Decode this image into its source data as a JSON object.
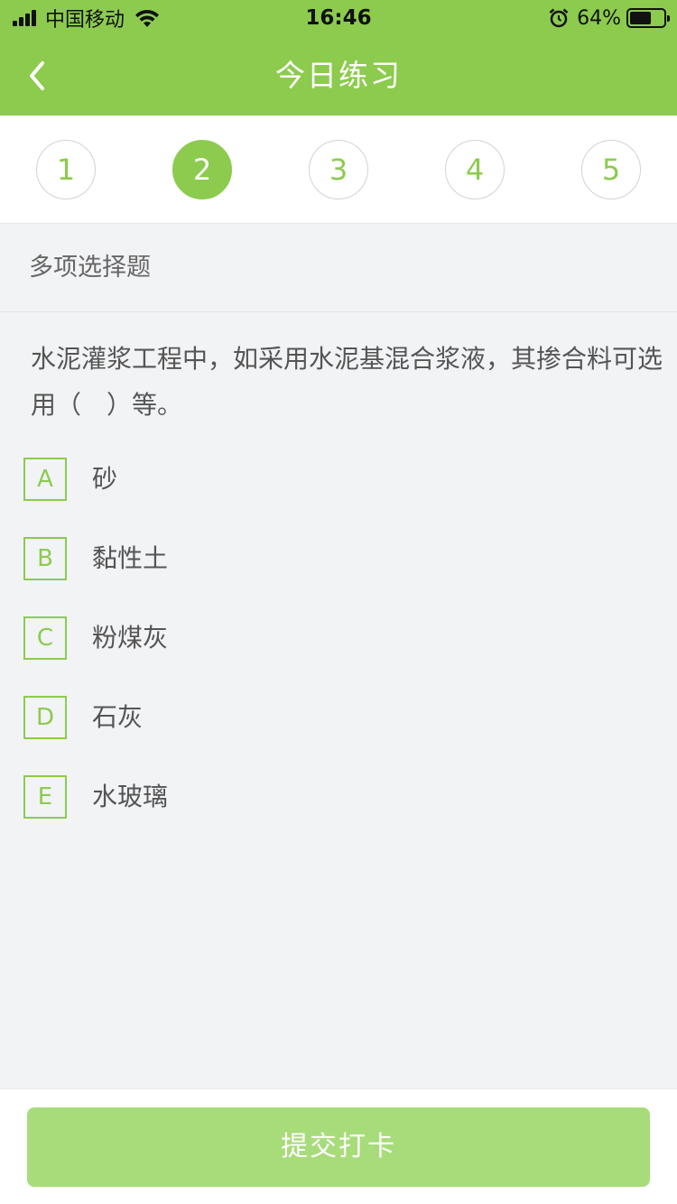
{
  "status_bar": {
    "carrier": "中国移动",
    "time": "16:46",
    "battery_percent": "64%",
    "battery_level": 0.64,
    "icons": [
      "signal-icon",
      "wifi-icon",
      "alarm-icon",
      "battery-icon"
    ]
  },
  "nav": {
    "title": "今日练习",
    "back_icon": "chevron-left-icon"
  },
  "questions": {
    "numbers": [
      "1",
      "2",
      "3",
      "4",
      "5"
    ],
    "current": "2"
  },
  "question": {
    "type": "多项选择题",
    "text": "水泥灌浆工程中，如采用水泥基混合浆液，其掺合料可选用（　）等。",
    "options": [
      {
        "letter": "A",
        "text": "砂"
      },
      {
        "letter": "B",
        "text": "黏性土"
      },
      {
        "letter": "C",
        "text": "粉煤灰"
      },
      {
        "letter": "D",
        "text": "石灰"
      },
      {
        "letter": "E",
        "text": "水玻璃"
      }
    ]
  },
  "footer": {
    "submit_label": "提交打卡"
  },
  "colors": {
    "brand": "#8ccb4e",
    "button_disabled": "#a8dc7a",
    "background": "#f2f3f5"
  }
}
